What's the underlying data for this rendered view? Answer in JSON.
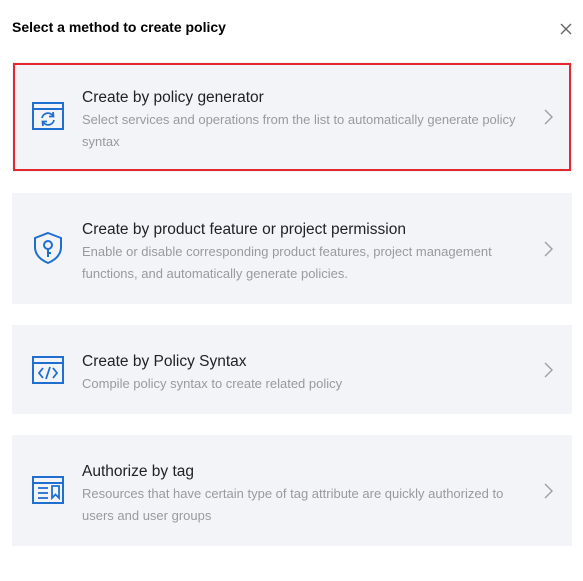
{
  "dialog": {
    "title": "Select a method to create policy"
  },
  "options": [
    {
      "title": "Create by policy generator",
      "description": "Select services and operations from the list to automatically generate policy syntax"
    },
    {
      "title": "Create by product feature or project permission",
      "description": "Enable or disable corresponding product features, project management functions, and automatically generate policies."
    },
    {
      "title": "Create by Policy Syntax",
      "description": "Compile policy syntax to create related policy"
    },
    {
      "title": "Authorize by tag",
      "description": "Resources that have certain type of tag attribute are quickly authorized to users and user groups"
    }
  ],
  "colors": {
    "icon": "#1f6fd0",
    "highlight_border": "#e5282f",
    "card_bg": "#f2f4f8"
  }
}
